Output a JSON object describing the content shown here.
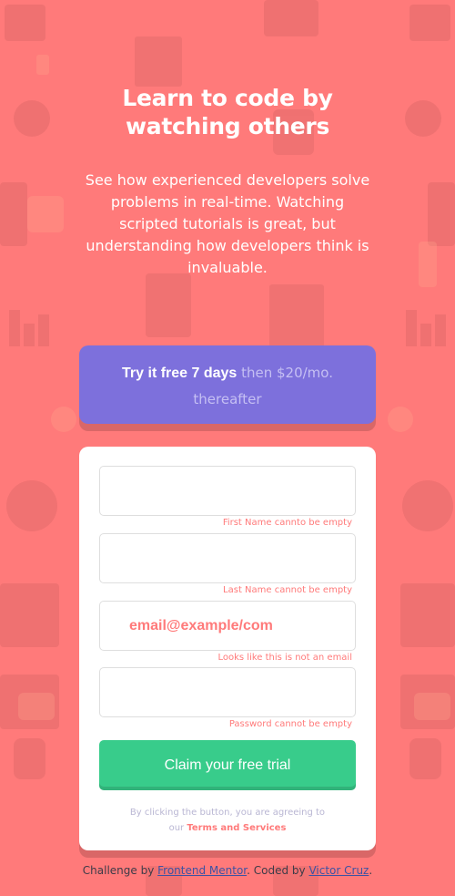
{
  "headline": {
    "line1": "Learn to code by",
    "line2": "watching others"
  },
  "intro": "See how experienced developers solve problems in real-time. Watching scripted tutorials is great, but understanding how developers think is invaluable.",
  "promo": {
    "strong": "Try it free 7 days",
    "light": " then $20/mo. thereafter"
  },
  "form": {
    "first_name": {
      "value": "",
      "error": "First Name cannto be empty"
    },
    "last_name": {
      "value": "",
      "error": "Last Name cannot be empty"
    },
    "email": {
      "value": "email@example/com",
      "error": "Looks like this is not an email"
    },
    "password": {
      "value": "",
      "error": "Password cannot be empty"
    },
    "submit_label": "Claim your free trial",
    "terms_prefix": "By clicking the button, you are agreeing to",
    "terms_our": "our ",
    "terms_link": "Terms and Services"
  },
  "attribution": {
    "prefix": "Challenge by ",
    "link1": "Frontend Mentor",
    "middle": ". Coded by ",
    "link2": "Victor Cruz",
    "suffix": "."
  },
  "colors": {
    "background": "#ff7a7a",
    "promo": "#7d70dc",
    "cta": "#38cc8b",
    "error": "#ff7a7a"
  }
}
